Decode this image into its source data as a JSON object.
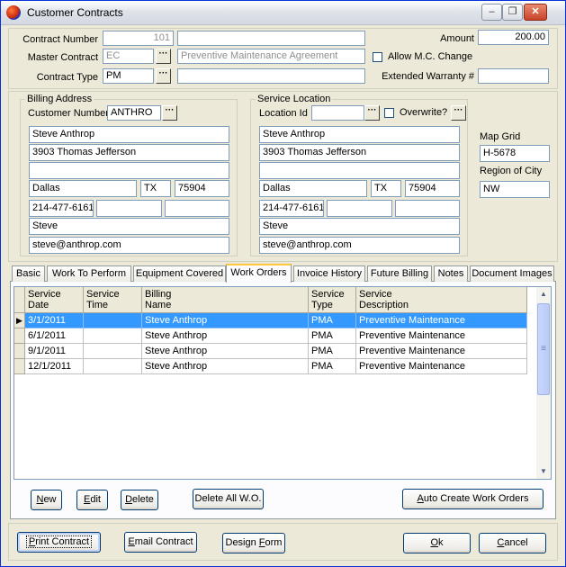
{
  "window": {
    "title": "Customer Contracts",
    "minimize": "–",
    "restore": "❐",
    "close": "✕"
  },
  "header": {
    "contract_number_label": "Contract Number",
    "contract_number_value": "101",
    "contract_number_desc": "",
    "master_contract_label": "Master Contract",
    "master_contract_value": "EC",
    "master_contract_desc": "Preventive Maintenance Agreement",
    "contract_type_label": "Contract Type",
    "contract_type_value": "PM",
    "contract_type_desc": "",
    "amount_label": "Amount",
    "amount_value": "200.00",
    "allow_mc_change_label": "Allow M.C. Change",
    "extended_warranty_label": "Extended Warranty #",
    "extended_warranty_value": ""
  },
  "billing": {
    "group_title": "Billing Address",
    "customer_number_label": "Customer Number",
    "customer_number_value": "ANTHRO",
    "name": "Steve Anthrop",
    "address1": "3903 Thomas Jefferson",
    "address2": "",
    "city": "Dallas",
    "state": "TX",
    "zip": "75904",
    "phone": "214-477-6161",
    "phone2": "",
    "phone3": "",
    "contact": "Steve",
    "email": "steve@anthrop.com"
  },
  "service": {
    "group_title": "Service Location",
    "location_id_label": "Location Id",
    "location_id_value": "",
    "overwrite_label": "Overwrite?",
    "name": "Steve Anthrop",
    "address1": "3903 Thomas Jefferson",
    "address2": "",
    "city": "Dallas",
    "state": "TX",
    "zip": "75904",
    "phone": "214-477-6161",
    "phone2": "",
    "phone3": "",
    "contact": "Steve",
    "email": "steve@anthrop.com"
  },
  "side": {
    "map_grid_label": "Map Grid",
    "map_grid_value": "H-5678",
    "region_label": "Region of City",
    "region_value": "NW"
  },
  "tabs": [
    {
      "label": "Basic"
    },
    {
      "label": "Work To Perform"
    },
    {
      "label": "Equipment Covered"
    },
    {
      "label": "Work Orders"
    },
    {
      "label": "Invoice History"
    },
    {
      "label": "Future Billing"
    },
    {
      "label": "Notes"
    },
    {
      "label": "Document Images"
    }
  ],
  "grid": {
    "columns": [
      {
        "line1": "Service",
        "line2": "Date"
      },
      {
        "line1": "Service",
        "line2": "Time"
      },
      {
        "line1": "Billing",
        "line2": "Name"
      },
      {
        "line1": "Service",
        "line2": "Type"
      },
      {
        "line1": "Service",
        "line2": "Description"
      }
    ],
    "rows": [
      {
        "date": "3/1/2011",
        "time": "",
        "name": "Steve Anthrop",
        "type": "PMA",
        "desc": "Preventive Maintenance"
      },
      {
        "date": "6/1/2011",
        "time": "",
        "name": "Steve Anthrop",
        "type": "PMA",
        "desc": "Preventive Maintenance"
      },
      {
        "date": "9/1/2011",
        "time": "",
        "name": "Steve Anthrop",
        "type": "PMA",
        "desc": "Preventive Maintenance"
      },
      {
        "date": "12/1/2011",
        "time": "",
        "name": "Steve Anthrop",
        "type": "PMA",
        "desc": "Preventive Maintenance"
      }
    ]
  },
  "buttons": {
    "new_u": "N",
    "new_rest": "ew",
    "edit_u": "E",
    "edit_rest": "dit",
    "delete_u": "D",
    "delete_rest": "elete",
    "delete_all": "Delete All W.O.",
    "auto_create_u": "A",
    "auto_create_rest": "uto Create Work Orders",
    "print_u": "P",
    "print_rest": "rint Contract",
    "email_u": "E",
    "email_rest": "mail Contract",
    "design_pre": "Design ",
    "design_u": "F",
    "design_rest": "orm",
    "ok_u": "O",
    "ok_rest": "k",
    "cancel_u": "C",
    "cancel_rest": "ancel"
  }
}
